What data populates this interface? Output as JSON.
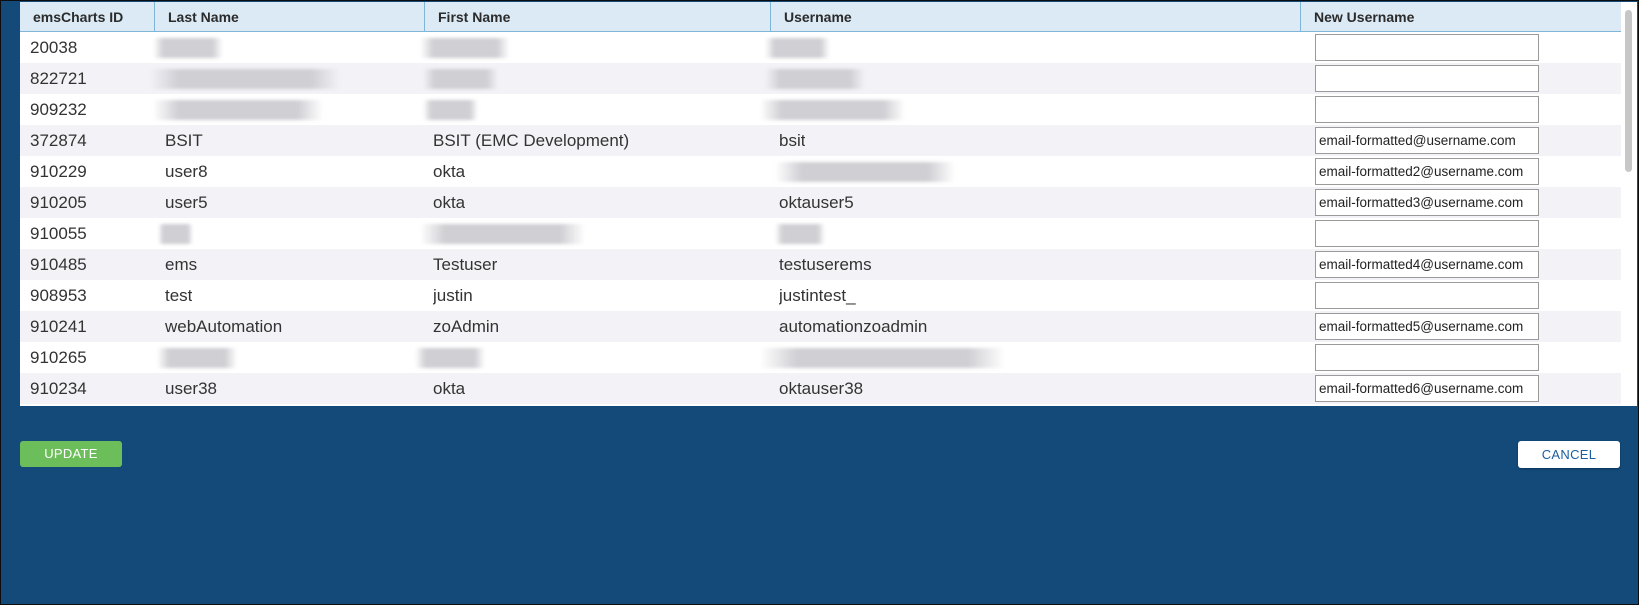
{
  "table": {
    "columns": [
      "emsCharts ID",
      "Last Name",
      "First Name",
      "Username",
      "New Username"
    ],
    "rows": [
      {
        "id": "20038",
        "last": "",
        "first": "",
        "username": "",
        "new_username": ""
      },
      {
        "id": "822721",
        "last": "",
        "first": "",
        "username": "",
        "new_username": ""
      },
      {
        "id": "909232",
        "last": "",
        "first": "",
        "username": "",
        "new_username": ""
      },
      {
        "id": "372874",
        "last": "BSIT",
        "first": "BSIT (EMC Development)",
        "username": "bsit",
        "new_username": "email-formatted@username.com"
      },
      {
        "id": "910229",
        "last": "user8",
        "first": "okta",
        "username": "",
        "new_username": "email-formatted2@username.com"
      },
      {
        "id": "910205",
        "last": "user5",
        "first": "okta",
        "username": "oktauser5",
        "new_username": "email-formatted3@username.com"
      },
      {
        "id": "910055",
        "last": "",
        "first": "",
        "username": "",
        "new_username": ""
      },
      {
        "id": "910485",
        "last": "ems",
        "first": "Testuser",
        "username": "testuserems",
        "new_username": "email-formatted4@username.com"
      },
      {
        "id": "908953",
        "last": "test",
        "first": "justin",
        "username": "justintest_",
        "new_username": ""
      },
      {
        "id": "910241",
        "last": "webAutomation",
        "first": "zoAdmin",
        "username": "automationzoadmin",
        "new_username": "email-formatted5@username.com"
      },
      {
        "id": "910265",
        "last": "",
        "first": "",
        "username": "",
        "new_username": ""
      },
      {
        "id": "910234",
        "last": "user38",
        "first": "okta",
        "username": "oktauser38",
        "new_username": "email-formatted6@username.com"
      }
    ]
  },
  "buttons": {
    "update": "UPDATE",
    "cancel": "CANCEL"
  },
  "colors": {
    "background": "#134a7a",
    "header_bg": "#dbeaf5",
    "update_button": "#6cbe5a",
    "cancel_text": "#1b5fa0"
  }
}
